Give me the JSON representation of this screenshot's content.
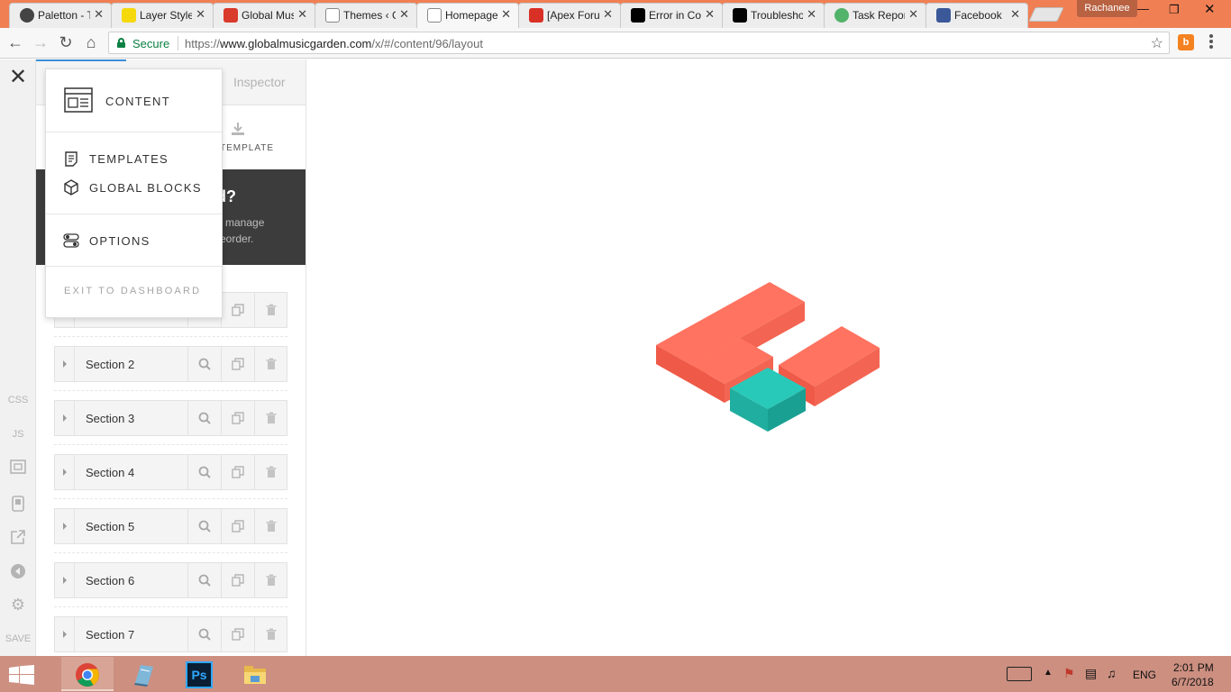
{
  "browser": {
    "tabs": [
      {
        "title": "Paletton - T",
        "icon": "paletton-icon",
        "icon_color": "#444444",
        "active": false
      },
      {
        "title": "Layer Styles",
        "icon": "layerstyles-icon",
        "icon_color": "#f5d90a",
        "active": false
      },
      {
        "title": "Global Music",
        "icon": "flame-icon",
        "icon_color": "#d93a2b",
        "active": false
      },
      {
        "title": "Themes ‹ Gl",
        "icon": "page-icon",
        "icon_color": "#ffffff",
        "active": false
      },
      {
        "title": "Homepage",
        "icon": "page-icon",
        "icon_color": "#ffffff",
        "active": true
      },
      {
        "title": "[Apex Forum",
        "icon": "gmail-icon",
        "icon_color": "#d93025",
        "active": false
      },
      {
        "title": "Error in Con",
        "icon": "x-brand-icon",
        "icon_color": "#000000",
        "active": false
      },
      {
        "title": "Troubleshoot",
        "icon": "x-brand-icon",
        "icon_color": "#000000",
        "active": false
      },
      {
        "title": "Task Report",
        "icon": "cloud-icon",
        "icon_color": "#52b36b",
        "active": false
      },
      {
        "title": "Facebook",
        "icon": "facebook-icon",
        "icon_color": "#3b5998",
        "active": false
      }
    ],
    "profile_name": "Rachanee",
    "secure_label": "Secure",
    "url_scheme": "https://",
    "url_host": "www.globalmusicgarden.com",
    "url_path": "/x/#/content/96/layout",
    "ext_label": "b",
    "colors": {
      "tabstrip": "#f07f54",
      "secure": "#0b8043"
    }
  },
  "rail": {
    "close_icon": "close-icon",
    "items": [
      "CSS",
      "JS"
    ],
    "save_label": "SAVE"
  },
  "panel": {
    "inspector_tab": "Inspector",
    "save_template": "TEMPLATE",
    "help_title": "d?",
    "help_body": "o manage reorder.",
    "sections": [
      {
        "name": ""
      },
      {
        "name": "Section 2"
      },
      {
        "name": "Section 3"
      },
      {
        "name": "Section 4"
      },
      {
        "name": "Section 5"
      },
      {
        "name": "Section 6"
      },
      {
        "name": "Section 7"
      }
    ]
  },
  "menu": {
    "content": "CONTENT",
    "templates": "TEMPLATES",
    "global_blocks": "GLOBAL BLOCKS",
    "options": "OPTIONS",
    "exit": "EXIT TO DASHBOARD"
  },
  "logo": {
    "primary_color": "#ff7360",
    "accent_color": "#22c1b2"
  },
  "taskbar": {
    "apps": [
      "chrome",
      "notepad",
      "photoshop",
      "file-explorer"
    ],
    "ps_label": "Ps",
    "language": "ENG",
    "time": "2:01 PM",
    "date": "6/7/2018"
  }
}
